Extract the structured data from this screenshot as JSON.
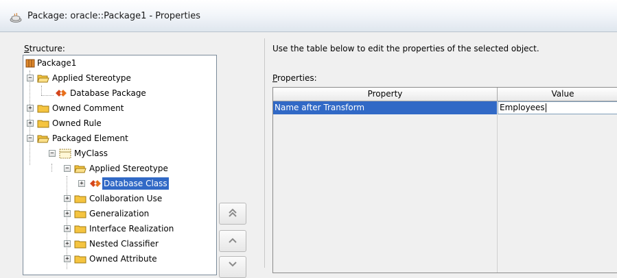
{
  "window": {
    "title": "Package: oracle::Package1 - Properties"
  },
  "structure": {
    "label": "Structure:",
    "tree": [
      {
        "id": "package1",
        "label": "Package1",
        "icon": "package-icon",
        "toggle": ""
      },
      {
        "id": "applied-stereotype",
        "label": "Applied Stereotype",
        "icon": "folder-open-icon",
        "toggle": "−"
      },
      {
        "id": "database-package",
        "label": "Database Package",
        "icon": "stereotype-icon",
        "toggle": ""
      },
      {
        "id": "owned-comment",
        "label": "Owned Comment",
        "icon": "folder-icon",
        "toggle": "+"
      },
      {
        "id": "owned-rule",
        "label": "Owned Rule",
        "icon": "folder-icon",
        "toggle": "+"
      },
      {
        "id": "packaged-element",
        "label": "Packaged Element",
        "icon": "folder-open-icon",
        "toggle": "−"
      },
      {
        "id": "myclass",
        "label": "MyClass",
        "icon": "class-icon",
        "toggle": "−"
      },
      {
        "id": "myclass-applied-stereotype",
        "label": "Applied Stereotype",
        "icon": "folder-open-icon",
        "toggle": "−"
      },
      {
        "id": "database-class",
        "label": "Database Class",
        "icon": "stereotype-icon",
        "toggle": "+"
      },
      {
        "id": "collaboration-use",
        "label": "Collaboration Use",
        "icon": "folder-icon",
        "toggle": "+"
      },
      {
        "id": "generalization",
        "label": "Generalization",
        "icon": "folder-icon",
        "toggle": "+"
      },
      {
        "id": "interface-realization",
        "label": "Interface Realization",
        "icon": "folder-icon",
        "toggle": "+"
      },
      {
        "id": "nested-classifier",
        "label": "Nested Classifier",
        "icon": "folder-icon",
        "toggle": "+"
      },
      {
        "id": "owned-attribute",
        "label": "Owned Attribute",
        "icon": "folder-icon",
        "toggle": "+"
      }
    ],
    "selected": "Database Class"
  },
  "move_buttons": [
    {
      "name": "move-to-top-button",
      "glyph": "⇞"
    },
    {
      "name": "move-up-button",
      "glyph": "⌃"
    },
    {
      "name": "move-down-button",
      "glyph": "⌄"
    }
  ],
  "properties_panel": {
    "instruction": "Use the table below to edit the properties of the selected object.",
    "label": "Properties:",
    "columns": [
      "Property",
      "Value"
    ],
    "rows": [
      {
        "property": "Name after Transform",
        "value": "Employees"
      }
    ]
  },
  "colors": {
    "selection": "#3169c6",
    "folder": "#f5c440",
    "stereotype": "#d4451b"
  }
}
